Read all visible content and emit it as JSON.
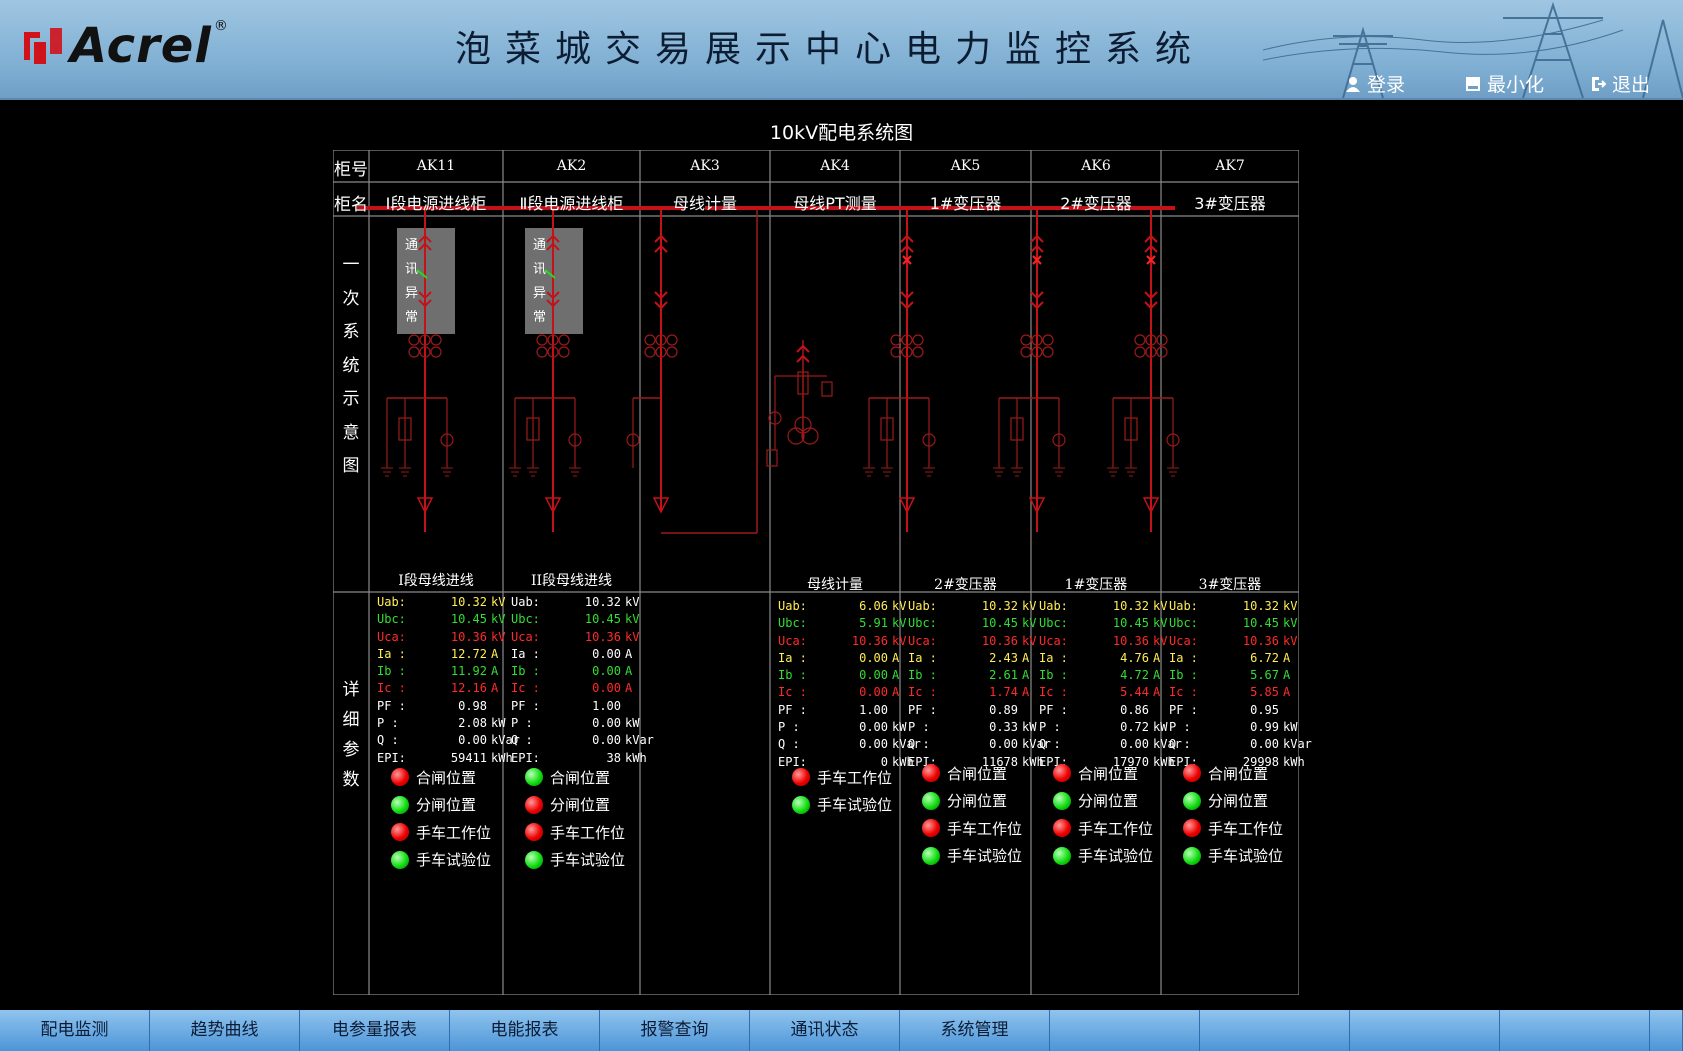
{
  "header": {
    "logo_text": "Acrel",
    "logo_reg": "®",
    "title": "泡菜城交易展示中心电力监控系统",
    "login": "登录",
    "minimize": "最小化",
    "exit": "退出"
  },
  "diagram": {
    "title": "10kV配电系统图",
    "row_code_label": "柜号",
    "row_name_label": "柜名",
    "section_single_line": [
      "一",
      "次",
      "系",
      "统",
      "示",
      "意",
      "图"
    ],
    "section_details": [
      "详",
      "细",
      "参",
      "数"
    ],
    "comm_fault": [
      "通",
      "讯",
      "异",
      "常"
    ],
    "cabinets": [
      {
        "code": "AK11",
        "name": "Ⅰ段电源进线柜"
      },
      {
        "code": "AK2",
        "name": "Ⅱ段电源进线柜"
      },
      {
        "code": "AK3",
        "name": "母线计量"
      },
      {
        "code": "AK4",
        "name": "母线PT测量"
      },
      {
        "code": "AK5",
        "name": "1#变压器"
      },
      {
        "code": "AK6",
        "name": "2#变压器"
      },
      {
        "code": "AK7",
        "name": "3#变压器"
      }
    ]
  },
  "panels": [
    {
      "title": "Ⅰ段母线进线",
      "rows": [
        {
          "k": "Uab:",
          "v": "10.32",
          "u": "kV",
          "c": "y"
        },
        {
          "k": "Ubc:",
          "v": "10.45",
          "u": "kV",
          "c": "g"
        },
        {
          "k": "Uca:",
          "v": "10.36",
          "u": "kV",
          "c": "r"
        },
        {
          "k": "Ia :",
          "v": "12.72",
          "u": "A",
          "c": "y"
        },
        {
          "k": "Ib :",
          "v": "11.92",
          "u": "A",
          "c": "g"
        },
        {
          "k": "Ic :",
          "v": "12.16",
          "u": "A",
          "c": "r"
        },
        {
          "k": "PF :",
          "v": "0.98",
          "u": "",
          "c": "w"
        },
        {
          "k": "P  :",
          "v": "2.08",
          "u": "kW",
          "c": "w"
        },
        {
          "k": "Q  :",
          "v": "0.00",
          "u": "kVar",
          "c": "w"
        },
        {
          "k": "EPI:",
          "v": "59411",
          "u": "kWh",
          "c": "w"
        }
      ],
      "status": [
        {
          "label": "合闸位置",
          "color": "red"
        },
        {
          "label": "分闸位置",
          "color": "green"
        },
        {
          "label": "手车工作位",
          "color": "red"
        },
        {
          "label": "手车试验位",
          "color": "green"
        }
      ]
    },
    {
      "title": "II段母线进线",
      "rows": [
        {
          "k": "Uab:",
          "v": "10.32",
          "u": "kV",
          "c": "w"
        },
        {
          "k": "Ubc:",
          "v": "10.45",
          "u": "kV",
          "c": "g"
        },
        {
          "k": "Uca:",
          "v": "10.36",
          "u": "kV",
          "c": "r"
        },
        {
          "k": "Ia :",
          "v": "0.00",
          "u": "A",
          "c": "w"
        },
        {
          "k": "Ib :",
          "v": "0.00",
          "u": "A",
          "c": "g"
        },
        {
          "k": "Ic :",
          "v": "0.00",
          "u": "A",
          "c": "r"
        },
        {
          "k": "PF :",
          "v": "1.00",
          "u": "",
          "c": "w"
        },
        {
          "k": "P  :",
          "v": "0.00",
          "u": "kW",
          "c": "w"
        },
        {
          "k": "Q  :",
          "v": "0.00",
          "u": "kVar",
          "c": "w"
        },
        {
          "k": "EPI:",
          "v": "38",
          "u": "kWh",
          "c": "w"
        }
      ],
      "status": [
        {
          "label": "合闸位置",
          "color": "green"
        },
        {
          "label": "分闸位置",
          "color": "red"
        },
        {
          "label": "手车工作位",
          "color": "red"
        },
        {
          "label": "手车试验位",
          "color": "green"
        }
      ]
    },
    {
      "title": "母线计量",
      "rows": [
        {
          "k": "Uab:",
          "v": "6.06",
          "u": "kV",
          "c": "y"
        },
        {
          "k": "Ubc:",
          "v": "5.91",
          "u": "kV",
          "c": "g"
        },
        {
          "k": "Uca:",
          "v": "10.36",
          "u": "kV",
          "c": "r"
        },
        {
          "k": "Ia :",
          "v": "0.00",
          "u": "A",
          "c": "y"
        },
        {
          "k": "Ib :",
          "v": "0.00",
          "u": "A",
          "c": "g"
        },
        {
          "k": "Ic :",
          "v": "0.00",
          "u": "A",
          "c": "r"
        },
        {
          "k": "PF :",
          "v": "1.00",
          "u": "",
          "c": "w"
        },
        {
          "k": "P  :",
          "v": "0.00",
          "u": "kW",
          "c": "w"
        },
        {
          "k": "Q  :",
          "v": "0.00",
          "u": "kVar",
          "c": "w"
        },
        {
          "k": "EPI:",
          "v": "0",
          "u": "kWh",
          "c": "w"
        }
      ],
      "status": [
        {
          "label": "手车工作位",
          "color": "red"
        },
        {
          "label": "手车试验位",
          "color": "green"
        }
      ]
    },
    {
      "title": "2#变压器",
      "rows": [
        {
          "k": "Uab:",
          "v": "10.32",
          "u": "kV",
          "c": "y"
        },
        {
          "k": "Ubc:",
          "v": "10.45",
          "u": "kV",
          "c": "g"
        },
        {
          "k": "Uca:",
          "v": "10.36",
          "u": "kV",
          "c": "r"
        },
        {
          "k": "Ia :",
          "v": "2.43",
          "u": "A",
          "c": "y"
        },
        {
          "k": "Ib :",
          "v": "2.61",
          "u": "A",
          "c": "g"
        },
        {
          "k": "Ic :",
          "v": "1.74",
          "u": "A",
          "c": "r"
        },
        {
          "k": "PF :",
          "v": "0.89",
          "u": "",
          "c": "w"
        },
        {
          "k": "P  :",
          "v": "0.33",
          "u": "kW",
          "c": "w"
        },
        {
          "k": "Q  :",
          "v": "0.00",
          "u": "kVar",
          "c": "w"
        },
        {
          "k": "EPI:",
          "v": "11678",
          "u": "kWh",
          "c": "w"
        }
      ],
      "status": [
        {
          "label": "合闸位置",
          "color": "red"
        },
        {
          "label": "分闸位置",
          "color": "green"
        },
        {
          "label": "手车工作位",
          "color": "red"
        },
        {
          "label": "手车试验位",
          "color": "green"
        }
      ]
    },
    {
      "title": "1#变压器",
      "rows": [
        {
          "k": "Uab:",
          "v": "10.32",
          "u": "kV",
          "c": "y"
        },
        {
          "k": "Ubc:",
          "v": "10.45",
          "u": "kV",
          "c": "g"
        },
        {
          "k": "Uca:",
          "v": "10.36",
          "u": "kV",
          "c": "r"
        },
        {
          "k": "Ia :",
          "v": "4.76",
          "u": "A",
          "c": "y"
        },
        {
          "k": "Ib :",
          "v": "4.72",
          "u": "A",
          "c": "g"
        },
        {
          "k": "Ic :",
          "v": "5.44",
          "u": "A",
          "c": "r"
        },
        {
          "k": "PF :",
          "v": "0.86",
          "u": "",
          "c": "w"
        },
        {
          "k": "P  :",
          "v": "0.72",
          "u": "kW",
          "c": "w"
        },
        {
          "k": "Q  :",
          "v": "0.00",
          "u": "kVar",
          "c": "w"
        },
        {
          "k": "EPI:",
          "v": "17970",
          "u": "kWh",
          "c": "w"
        }
      ],
      "status": [
        {
          "label": "合闸位置",
          "color": "red"
        },
        {
          "label": "分闸位置",
          "color": "green"
        },
        {
          "label": "手车工作位",
          "color": "red"
        },
        {
          "label": "手车试验位",
          "color": "green"
        }
      ]
    },
    {
      "title": "3#变压器",
      "rows": [
        {
          "k": "Uab:",
          "v": "10.32",
          "u": "kV",
          "c": "y"
        },
        {
          "k": "Ubc:",
          "v": "10.45",
          "u": "kV",
          "c": "g"
        },
        {
          "k": "Uca:",
          "v": "10.36",
          "u": "kV",
          "c": "r"
        },
        {
          "k": "Ia :",
          "v": "6.72",
          "u": "A",
          "c": "y"
        },
        {
          "k": "Ib :",
          "v": "5.67",
          "u": "A",
          "c": "g"
        },
        {
          "k": "Ic :",
          "v": "5.85",
          "u": "A",
          "c": "r"
        },
        {
          "k": "PF :",
          "v": "0.95",
          "u": "",
          "c": "w"
        },
        {
          "k": "P  :",
          "v": "0.99",
          "u": "kW",
          "c": "w"
        },
        {
          "k": "Q  :",
          "v": "0.00",
          "u": "kVar",
          "c": "w"
        },
        {
          "k": "EPI:",
          "v": "29998",
          "u": "kWh",
          "c": "w"
        }
      ],
      "status": [
        {
          "label": "合闸位置",
          "color": "red"
        },
        {
          "label": "分闸位置",
          "color": "green"
        },
        {
          "label": "手车工作位",
          "color": "red"
        },
        {
          "label": "手车试验位",
          "color": "green"
        }
      ]
    }
  ],
  "nav": [
    "配电监测",
    "趋势曲线",
    "电参量报表",
    "电能报表",
    "报警查询",
    "通讯状态",
    "系统管理",
    "",
    "",
    "",
    "",
    ""
  ],
  "colors": {
    "busbar": "#c4121a",
    "line": "#9a1a1a",
    "grid": "#8a8a8a",
    "nav_bg": "#5aa0e0"
  }
}
